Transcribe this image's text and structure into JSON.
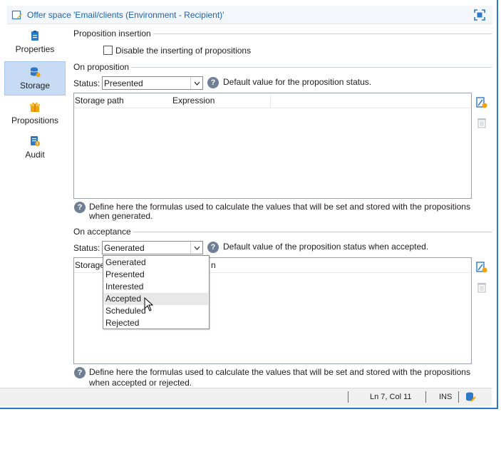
{
  "window": {
    "title": "Offer space 'Email/clients (Environment - Recipient)'"
  },
  "sidebar": {
    "items": [
      {
        "label": "Properties",
        "icon": "clipboard-icon",
        "active": false
      },
      {
        "label": "Storage",
        "icon": "database-sync-icon",
        "active": true
      },
      {
        "label": "Propositions",
        "icon": "gift-icon",
        "active": false
      },
      {
        "label": "Audit",
        "icon": "audit-icon",
        "active": false
      }
    ]
  },
  "proposition_insertion": {
    "title": "Proposition insertion",
    "checkbox_label": "Disable the inserting of propositions",
    "checked": false
  },
  "on_proposition": {
    "title": "On proposition",
    "status_label": "Status:",
    "status_value": "Presented",
    "status_help": "Default value for the proposition status.",
    "columns": [
      "Storage path",
      "Expression"
    ],
    "help_line1": "Define here the formulas used to calculate the values that will be set and stored with the propositions",
    "help_line2": "when generated."
  },
  "on_acceptance": {
    "title": "On acceptance",
    "status_label": "Status:",
    "status_value": "Generated",
    "status_help": "Default value of the proposition status when accepted.",
    "columns_visible": [
      "Storage",
      "n"
    ],
    "help_line1": "Define here the formulas used to calculate the values that will be set and stored with the propositions",
    "help_line2": "when accepted or rejected."
  },
  "dropdown": {
    "options": [
      "Generated",
      "Presented",
      "Interested",
      "Accepted",
      "Scheduled",
      "Rejected"
    ],
    "hovered": "Accepted"
  },
  "statusbar": {
    "position": "Ln 7, Col 11",
    "mode": "INS"
  },
  "colors": {
    "accent": "#2b79c9",
    "title_text": "#1a64b4",
    "active_nav": "#c7dcf4",
    "icon_orange": "#f0a30a"
  }
}
